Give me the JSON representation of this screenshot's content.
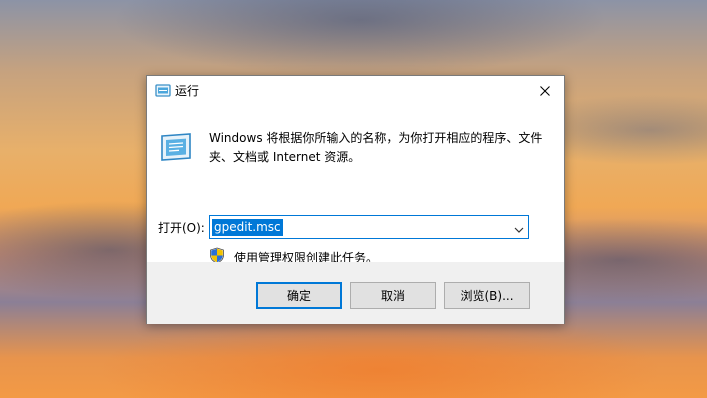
{
  "dialog": {
    "title": "运行",
    "description": "Windows 将根据你所输入的名称，为你打开相应的程序、文件夹、文档或 Internet 资源。",
    "open_label": "打开(O):",
    "input_value": "gpedit.msc",
    "admin_note": "使用管理权限创建此任务。"
  },
  "buttons": {
    "ok": "确定",
    "cancel": "取消",
    "browse": "浏览(B)..."
  },
  "icons": {
    "title": "run-app-icon",
    "main": "run-app-icon",
    "close": "close-icon",
    "dropdown": "chevron-down-icon",
    "admin": "uac-shield-icon"
  },
  "colors": {
    "accent": "#0078d7",
    "footer_bg": "#f0f0f0",
    "button_bg": "#e1e1e1"
  }
}
